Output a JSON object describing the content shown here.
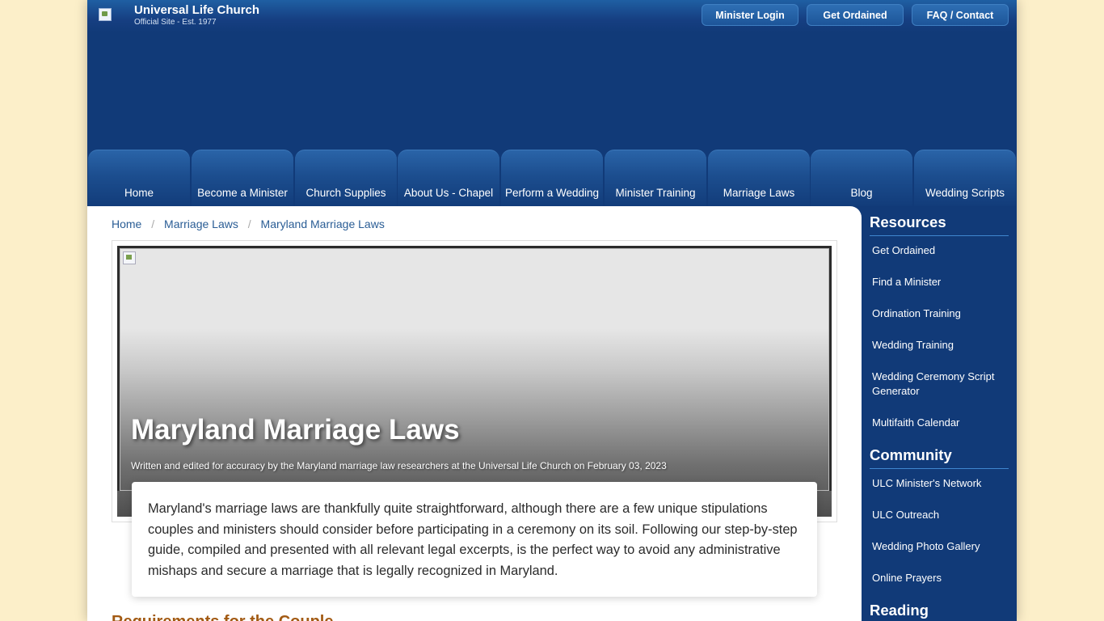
{
  "header": {
    "site_title": "Universal Life Church",
    "site_subtitle": "Official Site - Est. 1977",
    "buttons": [
      "Minister Login",
      "Get Ordained",
      "FAQ / Contact"
    ]
  },
  "nav": {
    "tabs": [
      "Home",
      "Become a Minister",
      "Church Supplies",
      "About Us - Chapel",
      "Perform a Wedding",
      "Minister Training",
      "Marriage Laws",
      "Blog",
      "Wedding Scripts"
    ]
  },
  "breadcrumb": [
    "Home",
    "Marriage Laws",
    "Maryland Marriage Laws"
  ],
  "hero": {
    "title": "Maryland Marriage Laws",
    "byline": "Written and edited for accuracy by the Maryland marriage law researchers at the Universal Life Church on February 03, 2023"
  },
  "intro": "Maryland's marriage laws are thankfully quite straightforward, although there are a few unique stipulations couples and ministers should consider before participating in a ceremony on its soil. Following our step-by-step guide, compiled and presented with all relevant legal excerpts, is the perfect way to avoid any administrative mishaps and secure a marriage that is legally recognized in Maryland.",
  "section_heading": "Requirements for the Couple",
  "sidebar": {
    "resources_heading": "Resources",
    "resources": [
      "Get Ordained",
      "Find a Minister",
      "Ordination Training",
      "Wedding Training",
      "Wedding Ceremony Script Generator",
      "Multifaith Calendar"
    ],
    "community_heading": "Community",
    "community": [
      "ULC Minister's Network",
      "ULC Outreach",
      "Wedding Photo Gallery",
      "Online Prayers"
    ],
    "reading_heading": "Reading"
  },
  "colors": {
    "page_background": "#fcefc9",
    "brand_blue": "#113a78",
    "heading_orange": "#a25a13",
    "link_blue": "#2a5d95"
  }
}
